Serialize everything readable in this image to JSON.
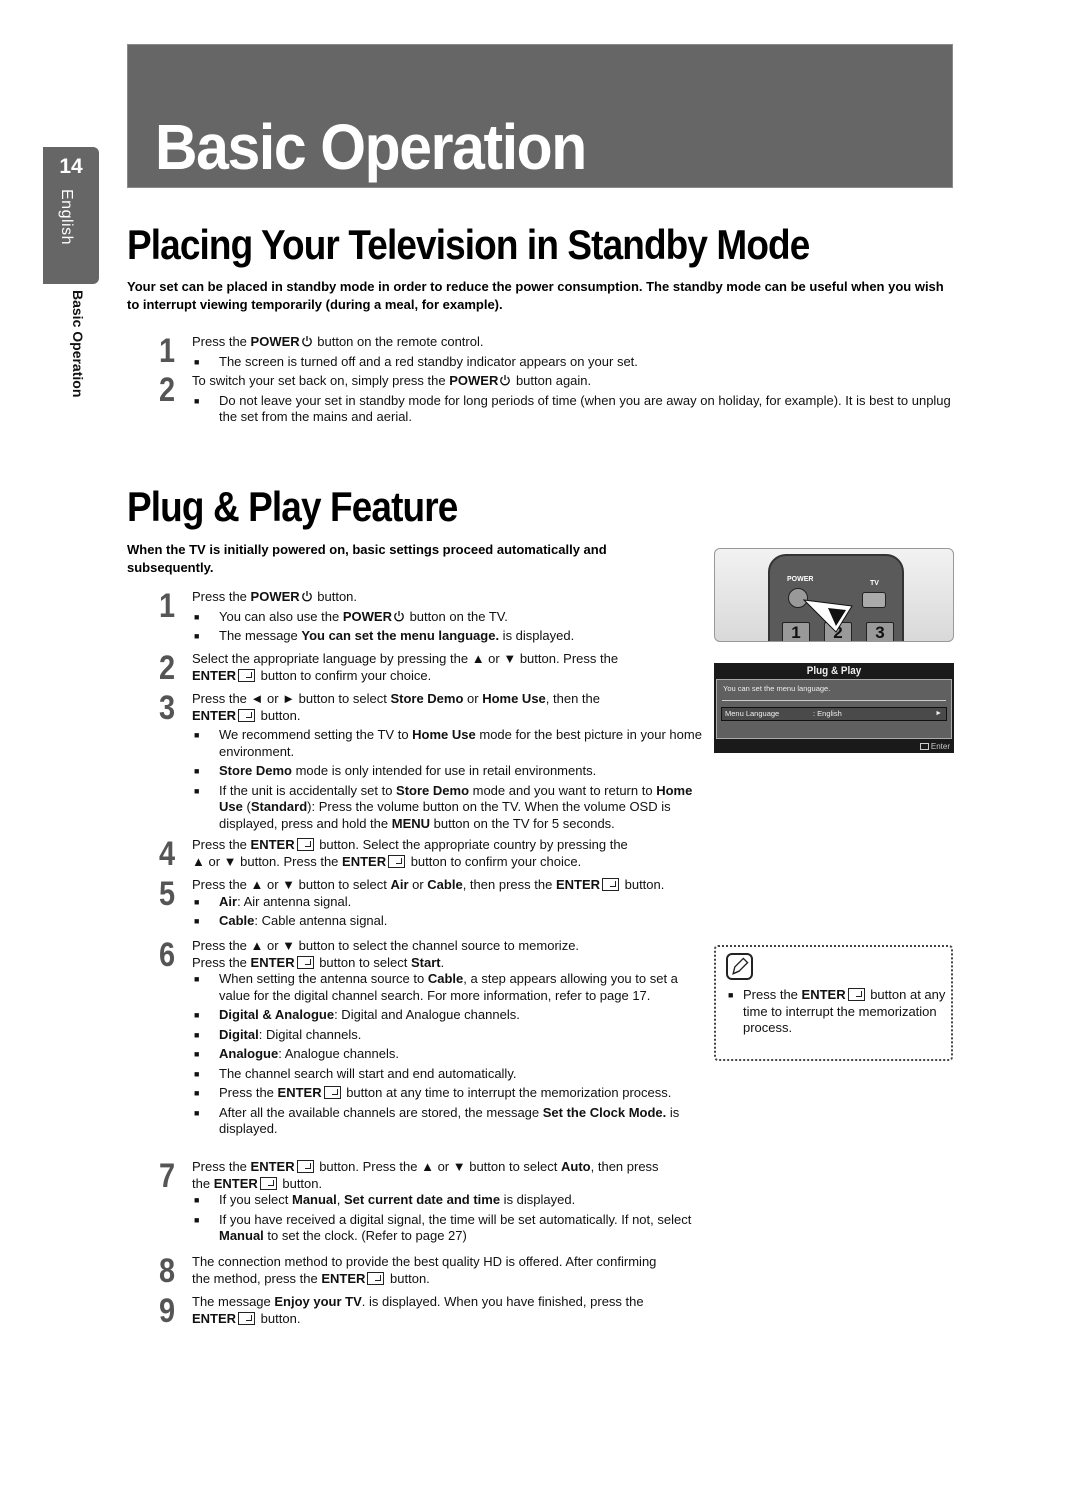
{
  "sidebar": {
    "page_number": "14",
    "language": "English",
    "section": "Basic Operation"
  },
  "banner": {
    "title": "Basic Operation"
  },
  "standby": {
    "heading": "Placing Your Television in Standby Mode",
    "intro": "Your set can be placed in standby mode in order to reduce the power consumption. The standby mode can be useful when you wish to interrupt viewing temporarily (during a meal, for example).",
    "steps": [
      {
        "number": "1",
        "text_pre": "Press the ",
        "bold": "POWER",
        "icon": "power-icon",
        "text_post": " button on the remote control.",
        "bullets": [
          "The screen is turned off and a red standby indicator appears on your set."
        ]
      },
      {
        "number": "2",
        "text_pre": "To switch your set back on, simply press the ",
        "bold": "POWER",
        "icon": "power-icon",
        "text_post": " button again.",
        "bullets": [
          "Do not leave your set in standby mode for long periods of time (when you are away on holiday, for example). It is best to unplug the set from the mains and aerial."
        ]
      }
    ]
  },
  "plugplay": {
    "heading": "Plug & Play Feature",
    "intro": "When the TV is initially powered on, basic settings proceed automatically and subsequently.",
    "steps": [
      {
        "number": "1"
      },
      {
        "number": "2"
      },
      {
        "number": "3"
      },
      {
        "number": "4"
      },
      {
        "number": "5"
      },
      {
        "number": "6"
      },
      {
        "number": "7"
      },
      {
        "number": "8"
      },
      {
        "number": "9"
      }
    ],
    "t": {
      "press_the": "Press the ",
      "power": "POWER",
      "enter": "ENTER",
      "button_dot": " button.",
      "s1_b1_pre": "You can also use the ",
      "s1_b1_post": " button on the TV.",
      "s1_b2_pre": "The message ",
      "s1_b2_bold": "You can set the menu language.",
      "s1_b2_post": " is displayed.",
      "s2_l1": "Select the appropriate language by pressing the ▲ or ▼ button. Press the",
      "s2_l2_post": " button to confirm your choice.",
      "s3_l1_a": "Press the ◄ or ► button to select ",
      "store_demo": "Store Demo",
      "or": " or ",
      "home_use": "Home Use",
      "s3_l1_b": ", then the",
      "s3_b1_pre": "We recommend setting the TV to ",
      "s3_b1_post": " mode for the best picture in your home environment.",
      "s3_b2_post": " mode is only intended for use in retail environments.",
      "s3_b3_a": "If the unit is accidentally set to ",
      "s3_b3_b": " mode and you want to return to ",
      "s3_b3_c": " (",
      "standard": "Standard",
      "s3_b3_d": "): Press the volume button on the TV. When the volume OSD is displayed, press and hold the ",
      "menu": "MENU",
      "s3_b3_e": " button on the TV for 5 seconds.",
      "s4_l1_post": " button. Select the appropriate country by pressing the",
      "s4_l2_a": "▲ or ▼ button. Press the ",
      "s4_l2_post": " button to confirm your choice.",
      "s5_a": "Press the ▲ or ▼ button to select ",
      "air": "Air",
      "cable": "Cable",
      "s5_b": ", then press the ",
      "s5_b1": ": Air antenna signal.",
      "s5_b2": ": Cable antenna signal.",
      "s6_l1": "Press the ▲ or ▼ button to select the channel source to memorize.",
      "s6_l2_post": " button to select ",
      "start": "Start",
      "s6_b1_a": "When setting the antenna source to ",
      "s6_b1_b": ", a step appears allowing you to set a value for the digital channel search. For more information, refer to  page 17.",
      "dig_analogue": "Digital & Analogue",
      "s6_b2": ": Digital and Analogue channels.",
      "digital": "Digital",
      "s6_b3": ": Digital channels.",
      "analogue": "Analogue",
      "s6_b4": ": Analogue channels.",
      "s6_b5": "The channel search will start and end automatically.",
      "s6_b6_post": " button at any time to interrupt the memorization process.",
      "s6_b7_a": "After all the available channels are stored, the message ",
      "set_clock": "Set the Clock Mode.",
      "s6_b7_b": " is displayed.",
      "s7_l1_post": " button. Press the ▲ or ▼ button to select ",
      "auto": "Auto",
      "s7_l1_b": ", then press",
      "the": "the ",
      "s7_b1_a": "If you select ",
      "manual": "Manual",
      "s7_b1_b": ", ",
      "set_date": "Set current date and time",
      "s7_b1_c": " is displayed.",
      "s7_b2_a": "If you have received a digital signal, the time will be set automatically. If not, select ",
      "s7_b2_b": " to set the clock. (Refer to page 27)",
      "s8_l1": "The connection method to provide the best quality HD is offered. After confirming",
      "s8_l2_pre": "the method, press the ",
      "s9_l1_a": "The message ",
      "enjoy": "Enjoy your TV",
      "s9_l1_b": ". is displayed. When you have finished, press the"
    }
  },
  "remote_illustration": {
    "power_label": "POWER",
    "tv_label": "TV",
    "keys": [
      "1",
      "2",
      "3"
    ]
  },
  "osd": {
    "title": "Plug & Play",
    "message": "You can set the menu language.",
    "row_label": "Menu Language",
    "row_value": ": English",
    "row_arrow": "►",
    "footer": "Enter"
  },
  "note": {
    "pre": "Press the ",
    "bold": "ENTER",
    "post": " button at any time to interrupt the memorization process."
  }
}
